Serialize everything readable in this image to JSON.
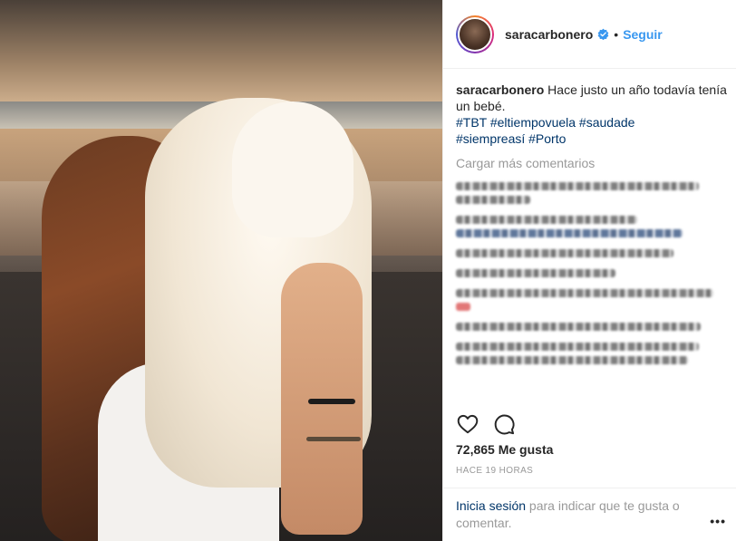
{
  "post": {
    "username": "saracarbonero",
    "verified": true,
    "separator": "•",
    "follow_label": "Seguir",
    "caption_user": "saracarbonero",
    "caption_text": " Hace justo un año todavía tenía un bebé.",
    "hashtags_line1": "#TBT #eltiempovuela #saudade",
    "hashtags_line2": "#siempreasí #Porto",
    "load_more_label": "Cargar más comentarios",
    "likes": "72,865 Me gusta",
    "timestamp": "HACE 19 HORAS"
  },
  "footer": {
    "login_link": "Inicia sesión",
    "login_text": " para indicar que te gusta o comentar.",
    "more_label": "•••"
  },
  "icons": {
    "verified": "verified-badge-icon",
    "like": "heart-icon",
    "comment": "comment-bubble-icon",
    "more": "more-options-icon"
  },
  "colors": {
    "link_blue": "#3897f0",
    "hashtag_navy": "#003569",
    "muted_gray": "#999999",
    "text": "#262626"
  }
}
